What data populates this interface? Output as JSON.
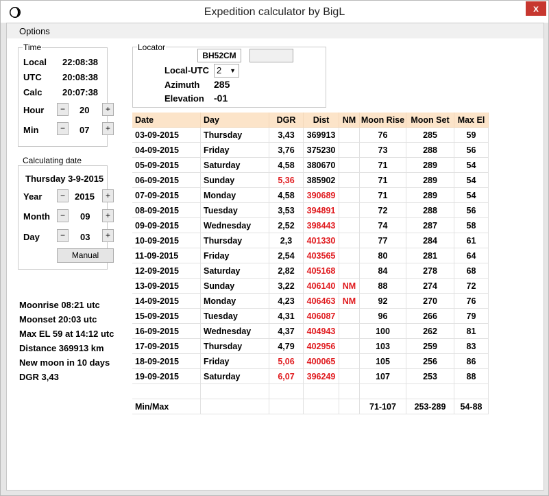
{
  "window": {
    "title": "Expedition calculator by BigL",
    "close_label": "x"
  },
  "menu": {
    "options_label": "Options"
  },
  "time": {
    "group_label": "Time",
    "local_label": "Local",
    "local_value": "22:08:38",
    "utc_label": "UTC",
    "utc_value": "20:08:38",
    "calc_label": "Calc",
    "calc_value": "20:07:38",
    "hour_label": "Hour",
    "hour_value": "20",
    "min_label": "Min",
    "min_value": "07",
    "minus": "−",
    "plus": "+"
  },
  "calc_date": {
    "group_label": "Calculating date",
    "date_text": "Thursday 3-9-2015",
    "year_label": "Year",
    "year_value": "2015",
    "month_label": "Month",
    "month_value": "09",
    "day_label": "Day",
    "day_value": "03",
    "manual_label": "Manual"
  },
  "locator": {
    "group_label": "Locator",
    "locator_value": "BH52CM",
    "local_utc_label": "Local-UTC",
    "local_utc_value": "2",
    "azimuth_label": "Azimuth",
    "azimuth_value": "285",
    "elevation_label": "Elevation",
    "elevation_value": "-01"
  },
  "summary": {
    "moonrise": "Moonrise 08:21 utc",
    "moonset": "Moonset 20:03 utc",
    "max_el": "Max EL 59 at 14:12 utc",
    "distance": "Distance 369913 km",
    "new_moon": "New moon in 10 days",
    "dgr": "DGR 3,43"
  },
  "table": {
    "columns": [
      "Date",
      "Day",
      "DGR",
      "Dist",
      "NM",
      "Moon Rise",
      "Moon Set",
      "Max El"
    ],
    "rows": [
      {
        "date": "03-09-2015",
        "day": "Thursday",
        "dgr": "3,43",
        "dgr_red": false,
        "dist": "369913",
        "dist_red": false,
        "nm": "",
        "rise": "76",
        "set": "285",
        "maxel": "59"
      },
      {
        "date": "04-09-2015",
        "day": "Friday",
        "dgr": "3,76",
        "dgr_red": false,
        "dist": "375230",
        "dist_red": false,
        "nm": "",
        "rise": "73",
        "set": "288",
        "maxel": "56"
      },
      {
        "date": "05-09-2015",
        "day": "Saturday",
        "dgr": "4,58",
        "dgr_red": false,
        "dist": "380670",
        "dist_red": false,
        "nm": "",
        "rise": "71",
        "set": "289",
        "maxel": "54"
      },
      {
        "date": "06-09-2015",
        "day": "Sunday",
        "dgr": "5,36",
        "dgr_red": true,
        "dist": "385902",
        "dist_red": false,
        "nm": "",
        "rise": "71",
        "set": "289",
        "maxel": "54"
      },
      {
        "date": "07-09-2015",
        "day": "Monday",
        "dgr": "4,58",
        "dgr_red": false,
        "dist": "390689",
        "dist_red": true,
        "nm": "",
        "rise": "71",
        "set": "289",
        "maxel": "54"
      },
      {
        "date": "08-09-2015",
        "day": "Tuesday",
        "dgr": "3,53",
        "dgr_red": false,
        "dist": "394891",
        "dist_red": true,
        "nm": "",
        "rise": "72",
        "set": "288",
        "maxel": "56"
      },
      {
        "date": "09-09-2015",
        "day": "Wednesday",
        "dgr": "2,52",
        "dgr_red": false,
        "dist": "398443",
        "dist_red": true,
        "nm": "",
        "rise": "74",
        "set": "287",
        "maxel": "58"
      },
      {
        "date": "10-09-2015",
        "day": "Thursday",
        "dgr": "2,3",
        "dgr_red": false,
        "dist": "401330",
        "dist_red": true,
        "nm": "",
        "rise": "77",
        "set": "284",
        "maxel": "61"
      },
      {
        "date": "11-09-2015",
        "day": "Friday",
        "dgr": "2,54",
        "dgr_red": false,
        "dist": "403565",
        "dist_red": true,
        "nm": "",
        "rise": "80",
        "set": "281",
        "maxel": "64"
      },
      {
        "date": "12-09-2015",
        "day": "Saturday",
        "dgr": "2,82",
        "dgr_red": false,
        "dist": "405168",
        "dist_red": true,
        "nm": "",
        "rise": "84",
        "set": "278",
        "maxel": "68"
      },
      {
        "date": "13-09-2015",
        "day": "Sunday",
        "dgr": "3,22",
        "dgr_red": false,
        "dist": "406140",
        "dist_red": true,
        "nm": "NM",
        "rise": "88",
        "set": "274",
        "maxel": "72"
      },
      {
        "date": "14-09-2015",
        "day": "Monday",
        "dgr": "4,23",
        "dgr_red": false,
        "dist": "406463",
        "dist_red": true,
        "nm": "NM",
        "rise": "92",
        "set": "270",
        "maxel": "76"
      },
      {
        "date": "15-09-2015",
        "day": "Tuesday",
        "dgr": "4,31",
        "dgr_red": false,
        "dist": "406087",
        "dist_red": true,
        "nm": "",
        "rise": "96",
        "set": "266",
        "maxel": "79"
      },
      {
        "date": "16-09-2015",
        "day": "Wednesday",
        "dgr": "4,37",
        "dgr_red": false,
        "dist": "404943",
        "dist_red": true,
        "nm": "",
        "rise": "100",
        "set": "262",
        "maxel": "81"
      },
      {
        "date": "17-09-2015",
        "day": "Thursday",
        "dgr": "4,79",
        "dgr_red": false,
        "dist": "402956",
        "dist_red": true,
        "nm": "",
        "rise": "103",
        "set": "259",
        "maxel": "83"
      },
      {
        "date": "18-09-2015",
        "day": "Friday",
        "dgr": "5,06",
        "dgr_red": true,
        "dist": "400065",
        "dist_red": true,
        "nm": "",
        "rise": "105",
        "set": "256",
        "maxel": "86"
      },
      {
        "date": "19-09-2015",
        "day": "Saturday",
        "dgr": "6,07",
        "dgr_red": true,
        "dist": "396249",
        "dist_red": true,
        "nm": "",
        "rise": "107",
        "set": "253",
        "maxel": "88"
      }
    ],
    "minmax": {
      "label": "Min/Max",
      "rise": "71-107",
      "set": "253-289",
      "maxel": "54-88"
    }
  },
  "colors": {
    "header_bg": "#fce4c9",
    "warning_red": "#e0191d",
    "close_red": "#c7372f"
  }
}
